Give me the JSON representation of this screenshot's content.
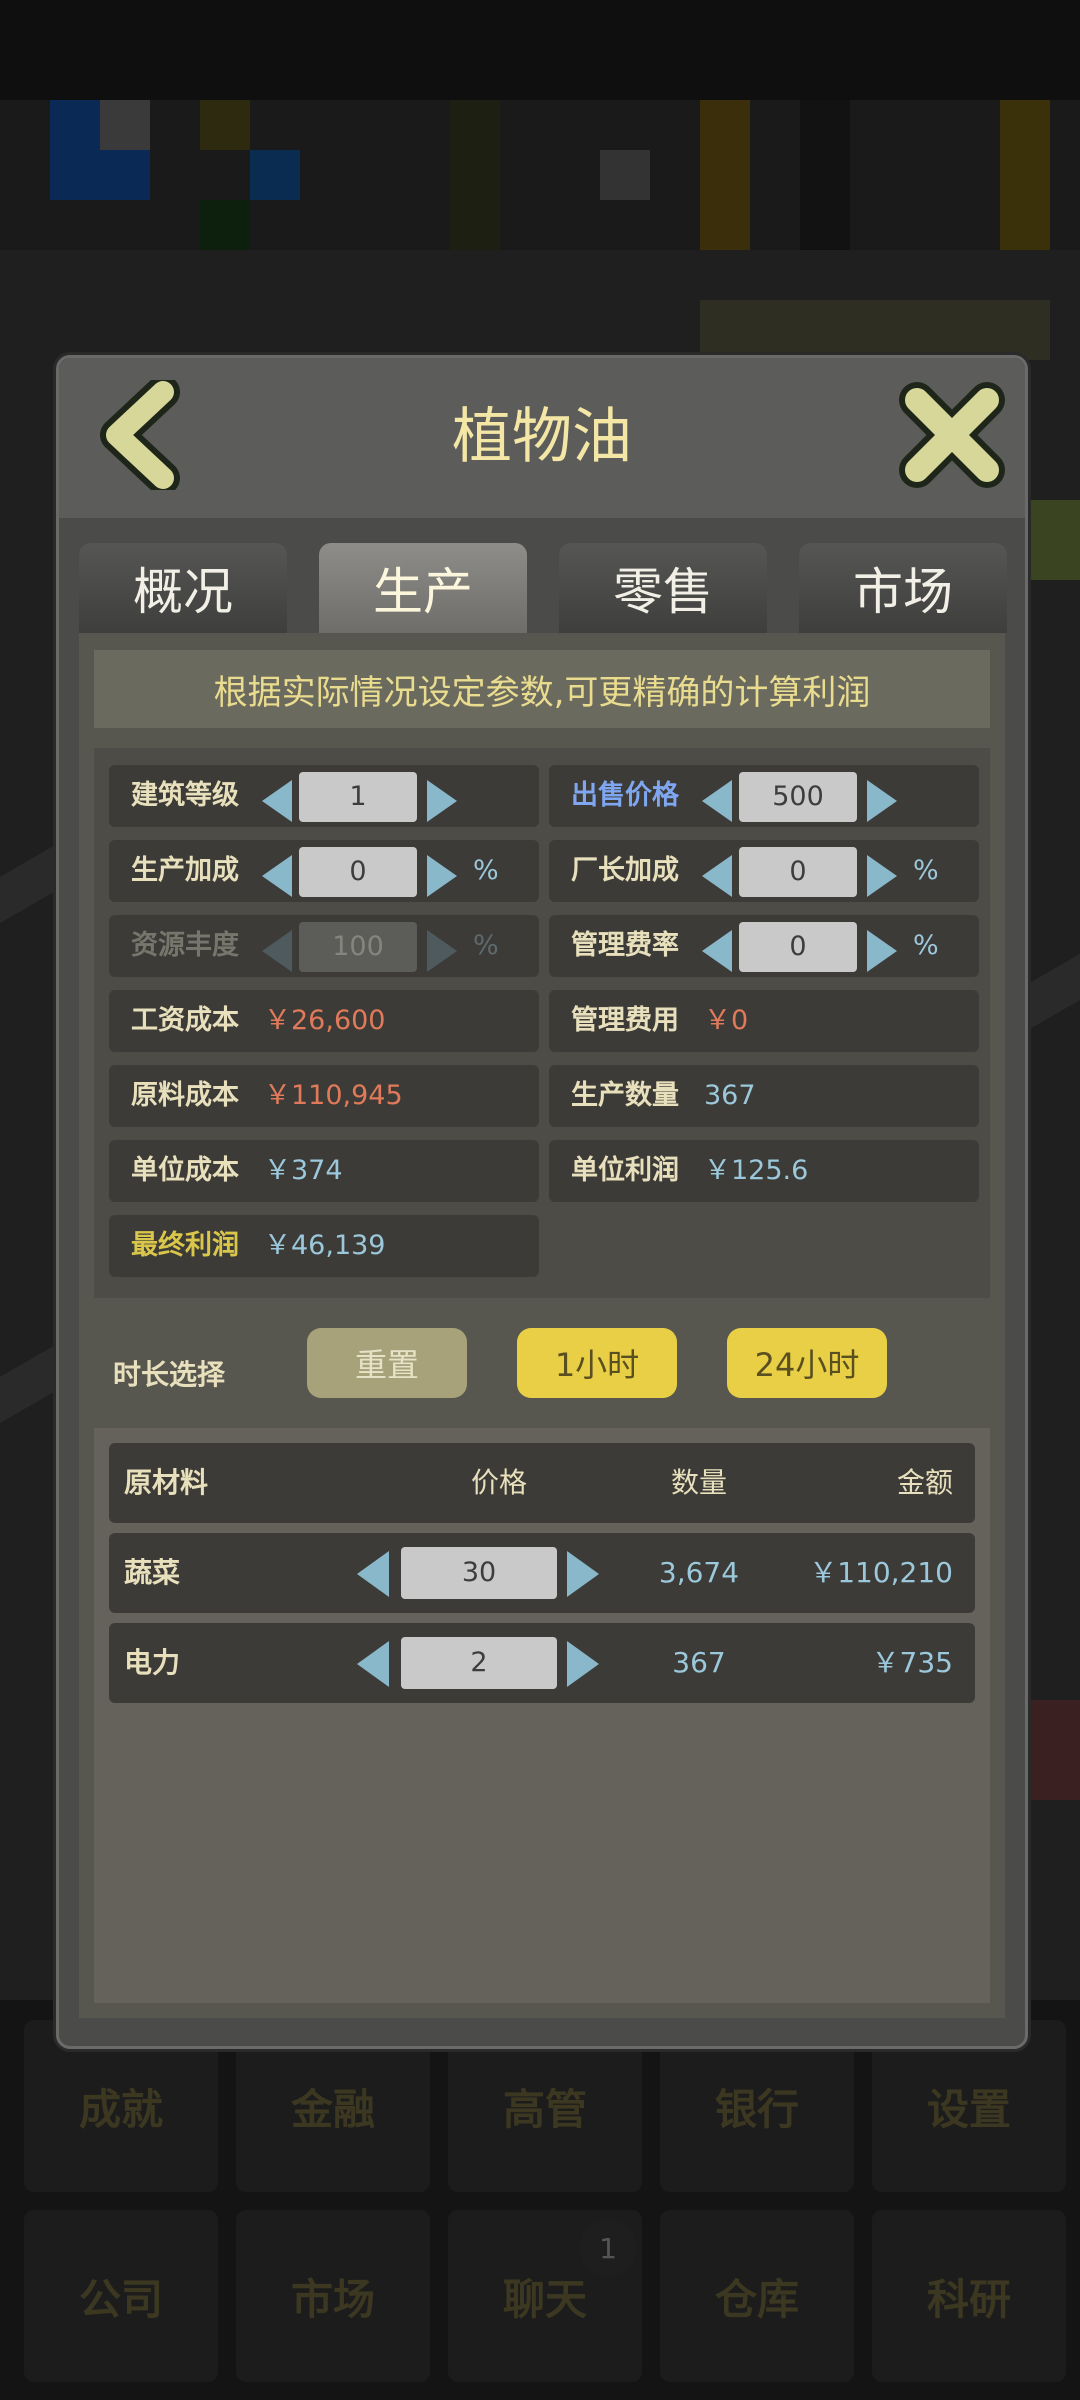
{
  "dialog": {
    "title": "植物油",
    "info": "根据实际情况设定参数,可更精确的计算利润"
  },
  "tabs": [
    {
      "label": "概况"
    },
    {
      "label": "生产"
    },
    {
      "label": "零售"
    },
    {
      "label": "市场"
    }
  ],
  "params": {
    "building_level": {
      "label": "建筑等级",
      "value": "1"
    },
    "sell_price": {
      "label": "出售价格",
      "value": "500"
    },
    "production_bonus": {
      "label": "生产加成",
      "value": "0",
      "unit": "%"
    },
    "manager_bonus": {
      "label": "厂长加成",
      "value": "0",
      "unit": "%"
    },
    "resource_richness": {
      "label": "资源丰度",
      "value": "100",
      "unit": "%"
    },
    "management_rate": {
      "label": "管理费率",
      "value": "0",
      "unit": "%"
    },
    "wage_cost": {
      "label": "工资成本",
      "value": "￥26,600"
    },
    "management_fee": {
      "label": "管理费用",
      "value": "￥0"
    },
    "material_cost": {
      "label": "原料成本",
      "value": "￥110,945"
    },
    "production_qty": {
      "label": "生产数量",
      "value": "367"
    },
    "unit_cost": {
      "label": "单位成本",
      "value": "￥374"
    },
    "unit_profit": {
      "label": "单位利润",
      "value": "￥125.6"
    },
    "final_profit": {
      "label": "最终利润",
      "value": "￥46,139"
    }
  },
  "duration": {
    "label": "时长选择",
    "reset": "重置",
    "one_hour": "1小时",
    "twentyfour_hours": "24小时"
  },
  "materials": {
    "headers": {
      "name": "原材料",
      "price": "价格",
      "qty": "数量",
      "amount": "金额"
    },
    "rows": [
      {
        "name": "蔬菜",
        "price": "30",
        "qty": "3,674",
        "amount": "￥110,210"
      },
      {
        "name": "电力",
        "price": "2",
        "qty": "367",
        "amount": "￥735"
      }
    ]
  },
  "bottom_menu": [
    {
      "label": "成就"
    },
    {
      "label": "金融"
    },
    {
      "label": "高管"
    },
    {
      "label": "银行"
    },
    {
      "label": "设置"
    },
    {
      "label": "公司"
    },
    {
      "label": "市场"
    },
    {
      "label": "聊天"
    },
    {
      "label": "仓库"
    },
    {
      "label": "科研"
    }
  ],
  "chat_badge": "1",
  "colors": {
    "accent_yellow": "#e8cf45",
    "title_text": "#f4e7a6",
    "cost_red": "#e07a5a",
    "value_blue": "#9cc8dc",
    "price_label_blue": "#7fa6f0"
  },
  "icons": {
    "back": "chevron-left-icon",
    "close": "close-icon",
    "stepper_left": "triangle-left-icon",
    "stepper_right": "triangle-right-icon"
  }
}
